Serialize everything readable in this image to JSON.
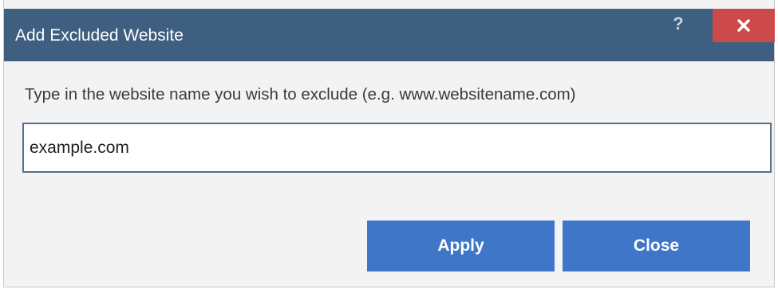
{
  "window": {
    "title": "Add Excluded Website",
    "help_label": "?",
    "close_icon": "close-icon",
    "titlebar_color": "#3e5f7f",
    "close_color": "#cd4a4a"
  },
  "form": {
    "instruction": "Type in the website name you wish to exclude (e.g. www.websitename.com)",
    "website_value": "example.com",
    "website_placeholder": ""
  },
  "buttons": {
    "apply_label": "Apply",
    "close_label": "Close",
    "accent_color": "#3f76c8"
  }
}
